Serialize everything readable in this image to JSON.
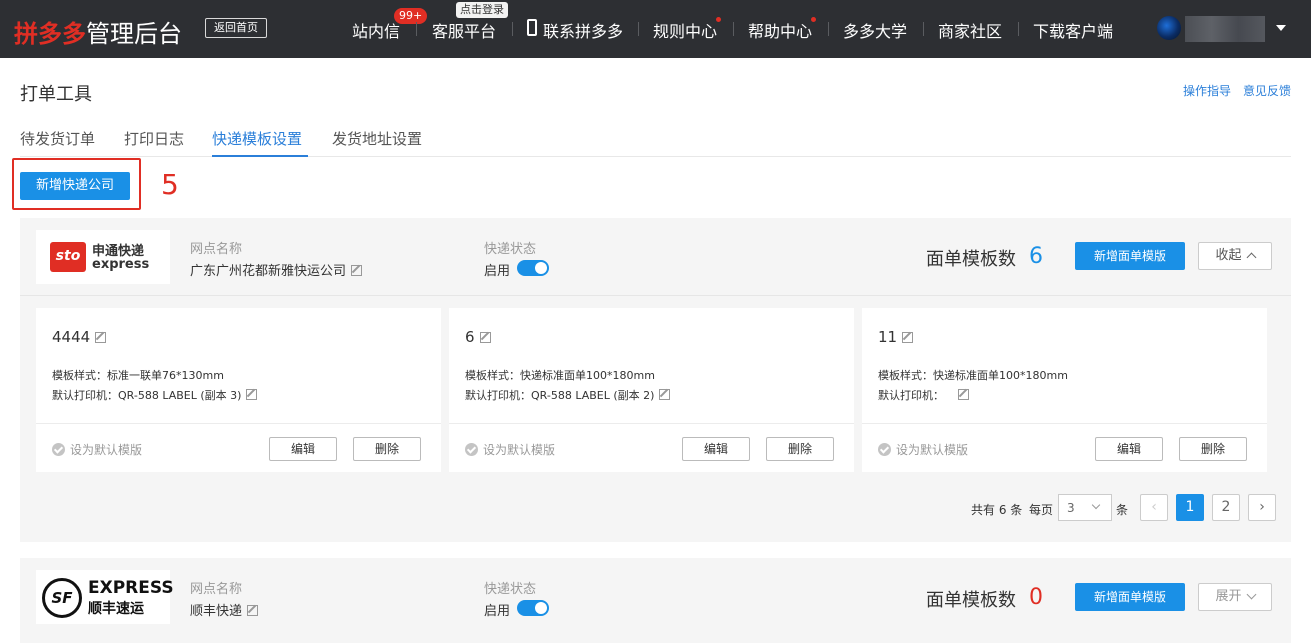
{
  "app": {
    "brand_red": "拼多多",
    "brand_white": "管理后台",
    "back_home": "返回首页"
  },
  "nav": {
    "items": [
      {
        "label": "站内信",
        "badge": "99+"
      },
      {
        "label": "客服平台",
        "tip": "点击登录"
      },
      {
        "label": "联系拼多多",
        "icon": "phone-icon"
      },
      {
        "label": "规则中心",
        "dot": true
      },
      {
        "label": "帮助中心",
        "dot": true
      },
      {
        "label": "多多大学"
      },
      {
        "label": "商家社区"
      },
      {
        "label": "下载客户端"
      }
    ]
  },
  "page": {
    "title": "打单工具",
    "guide_link": "操作指导",
    "feedback_link": "意见反馈",
    "tabs": [
      "待发货订单",
      "打印日志",
      "快递模板设置",
      "发货地址设置"
    ],
    "active_tab": "快递模板设置",
    "add_company_button": "新增快递公司",
    "annotation_number": "5"
  },
  "companies": [
    {
      "logo_main": "申通快递",
      "logo_sub": "express",
      "logo_mark": "sto",
      "outlet_label": "网点名称",
      "outlet_name": "广东广州花都新雅快运公司",
      "status_label": "快递状态",
      "status_value": "启用",
      "template_count_label": "面单模板数",
      "template_count": "6",
      "add_template_button": "新增面单模版",
      "toggle_button": "收起",
      "templates": [
        {
          "name": "4444",
          "style_line": "模板样式：标准一联单76*130mm",
          "printer_line": "默认打印机：QR-588 LABEL (副本 3)",
          "set_default": "设为默认模版",
          "edit": "编辑",
          "delete": "删除"
        },
        {
          "name": "6",
          "style_line": "模板样式：快递标准面单100*180mm",
          "printer_line": "默认打印机：QR-588 LABEL (副本 2)",
          "set_default": "设为默认模版",
          "edit": "编辑",
          "delete": "删除"
        },
        {
          "name": "11",
          "style_line": "模板样式：快递标准面单100*180mm",
          "printer_line": "默认打印机：",
          "set_default": "设为默认模版",
          "edit": "编辑",
          "delete": "删除"
        }
      ],
      "pagination": {
        "total": "共有 6 条",
        "per_page_label": "每页",
        "per_page_value": "3",
        "unit": "条",
        "pages": [
          "1",
          "2"
        ],
        "current": "1"
      }
    },
    {
      "logo_main": "顺丰速运",
      "logo_sub": "EXPRESS",
      "logo_mark": "SF",
      "outlet_label": "网点名称",
      "outlet_name": "顺丰快递",
      "status_label": "快递状态",
      "status_value": "启用",
      "template_count_label": "面单模板数",
      "template_count": "0",
      "add_template_button": "新增面单模版",
      "toggle_button": "展开"
    }
  ],
  "colors": {
    "topbar": "#2d2f33",
    "brand_red": "#e02e24",
    "primary": "#1a90e6",
    "link": "#2b7fd9",
    "count_blue": "#1a90e6",
    "count_red": "#e02e24"
  }
}
